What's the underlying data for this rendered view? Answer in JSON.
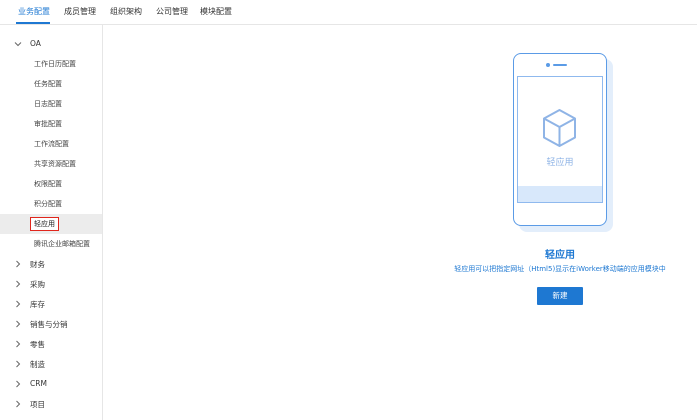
{
  "topnav": {
    "tabs": [
      {
        "label": "业务配置",
        "active": true
      },
      {
        "label": "成员管理"
      },
      {
        "label": "组织架构"
      },
      {
        "label": "公司管理"
      },
      {
        "label": "模块配置"
      }
    ]
  },
  "sidebar": {
    "oa_label": "OA",
    "oa_items": [
      "工作日历配置",
      "任务配置",
      "日志配置",
      "审批配置",
      "工作流配置",
      "共享资源配置",
      "权限配置",
      "积分配置",
      "轻应用",
      "腾讯企业邮箱配置"
    ],
    "selected_item": "轻应用",
    "groups": [
      "财务",
      "采购",
      "库存",
      "销售与分销",
      "零售",
      "制造",
      "CRM",
      "项目"
    ]
  },
  "main": {
    "screen_label": "轻应用",
    "title": "轻应用",
    "description": "轻应用可以把指定网址（Html5)显示在iWorker移动端的应用模块中",
    "new_button": "新建"
  },
  "colors": {
    "accent": "#1e78d2",
    "selection_border": "#e0261c",
    "phone_outline": "#5b9be6"
  },
  "icons": {
    "collapse": "chevron-down-icon",
    "expand": "chevron-right-icon",
    "app": "cube-icon"
  }
}
